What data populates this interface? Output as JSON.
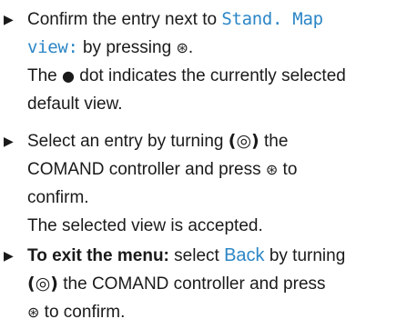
{
  "steps": [
    {
      "lead": "Confirm the entry next to ",
      "menu_item": "Stand. Map",
      "menu_item_2": "view:",
      "after": " by pressing ",
      "end": ".",
      "result_1": "The ",
      "result_2": " dot indicates the currently selected",
      "result_3": "default view."
    },
    {
      "lead": "Select an entry by turning ",
      "after": " the",
      "line_2": "COMAND controller and press ",
      "line_2_end": " to",
      "line_3": "confirm.",
      "result": "The selected view is accepted."
    },
    {
      "bold_lead": "To exit the menu:",
      "lead": " select ",
      "menu_item": "Back",
      "after": " by turning",
      "line_2": " the COMAND controller and press",
      "line_3": " to confirm."
    }
  ],
  "icons": {
    "bullet": "▶",
    "press_button": "press-button-icon",
    "turn_controller": "turn-controller-icon",
    "selected_dot": "●"
  },
  "colors": {
    "menu_text": "#2b86c6",
    "body_text": "#1a1a1a"
  }
}
